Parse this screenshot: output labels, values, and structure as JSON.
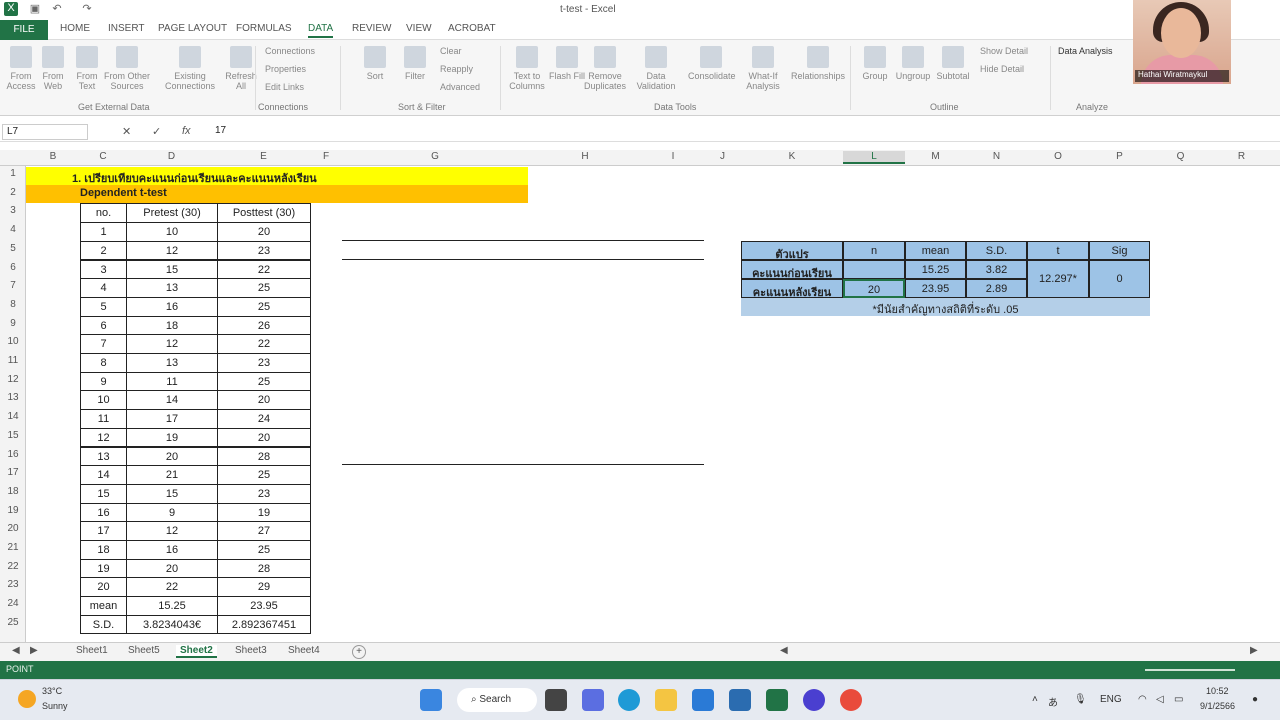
{
  "window": {
    "title": "t-test - Excel"
  },
  "tabs": [
    "FILE",
    "HOME",
    "INSERT",
    "PAGE LAYOUT",
    "FORMULAS",
    "DATA",
    "REVIEW",
    "VIEW",
    "ACROBAT"
  ],
  "ribbon": {
    "buttons": [
      "From Access",
      "From Web",
      "From Text",
      "From Other Sources",
      "Existing Connections",
      "Refresh All",
      "Sort",
      "Filter",
      "Text to Columns",
      "Flash Fill",
      "Remove Duplicates",
      "Data Validation",
      "Consolidate",
      "What-If Analysis",
      "Relationships",
      "Group",
      "Ungroup",
      "Subtotal"
    ],
    "small": [
      "Connections",
      "Properties",
      "Edit Links",
      "Clear",
      "Reapply",
      "Advanced",
      "Show Detail",
      "Hide Detail",
      "Data Analysis"
    ],
    "groups": [
      "Get External Data",
      "Connections",
      "Sort & Filter",
      "Data Tools",
      "Outline",
      "Analyze"
    ]
  },
  "webcam": {
    "name": "Hathai Wiratmaykul"
  },
  "formula": {
    "namebox": "L7",
    "value": "17"
  },
  "columns": [
    "B",
    "C",
    "D",
    "E",
    "F",
    "G",
    "H",
    "I",
    "J",
    "K",
    "L",
    "M",
    "N",
    "O",
    "P",
    "Q",
    "R"
  ],
  "rows": [
    "1",
    "2",
    "3",
    "4",
    "5",
    "6",
    "7",
    "8",
    "9",
    "10",
    "11",
    "12",
    "13",
    "14",
    "15",
    "16",
    "17",
    "18",
    "19",
    "20",
    "21",
    "22",
    "23",
    "24",
    "25"
  ],
  "sheet": {
    "title1": "1. เปรียบเทียบคะแนนก่อนเรียนและคะแนนหลังเรียน",
    "title2": "Dependent t-test",
    "headers": [
      "no.",
      "Pretest (30)",
      "Posttest (30)"
    ],
    "data": [
      [
        "1",
        "10",
        "20"
      ],
      [
        "2",
        "12",
        "23"
      ],
      [
        "3",
        "15",
        "22"
      ],
      [
        "4",
        "13",
        "25"
      ],
      [
        "5",
        "16",
        "25"
      ],
      [
        "6",
        "18",
        "26"
      ],
      [
        "7",
        "12",
        "22"
      ],
      [
        "8",
        "13",
        "23"
      ],
      [
        "9",
        "11",
        "25"
      ],
      [
        "10",
        "14",
        "20"
      ],
      [
        "11",
        "17",
        "24"
      ],
      [
        "12",
        "19",
        "20"
      ],
      [
        "13",
        "20",
        "28"
      ],
      [
        "14",
        "21",
        "25"
      ],
      [
        "15",
        "15",
        "23"
      ],
      [
        "16",
        "9",
        "19"
      ],
      [
        "17",
        "12",
        "27"
      ],
      [
        "18",
        "16",
        "25"
      ],
      [
        "19",
        "20",
        "28"
      ],
      [
        "20",
        "22",
        "29"
      ]
    ],
    "mean": [
      "mean",
      "15.25",
      "23.95"
    ],
    "sd": [
      "S.D.",
      "3.8234043€",
      "2.892367451"
    ]
  },
  "stats": {
    "headers": [
      "ตัวแปร",
      "n",
      "mean",
      "S.D.",
      "t",
      "Sig"
    ],
    "row1": [
      "คะแนนก่อนเรียน",
      "",
      "15.25",
      "3.82"
    ],
    "row2": [
      "คะแนนหลังเรียน",
      "20",
      "23.95",
      "2.89"
    ],
    "t": "12.297*",
    "sig": "0",
    "note": "*มีนัยสำคัญทางสถิติที่ระดับ .05"
  },
  "sheettabs": [
    "Sheet1",
    "Sheet5",
    "Sheet2",
    "Sheet3",
    "Sheet4"
  ],
  "status": "POINT",
  "taskbar": {
    "weather_temp": "33°C",
    "weather_text": "Sunny",
    "search": "Search",
    "lang": "ENG",
    "time": "10:52",
    "date": "9/1/2566"
  },
  "colors": {
    "excel_green": "#217346",
    "yellow": "#ffff00",
    "orange": "#ffc000",
    "blue": "#9dc3e6"
  }
}
